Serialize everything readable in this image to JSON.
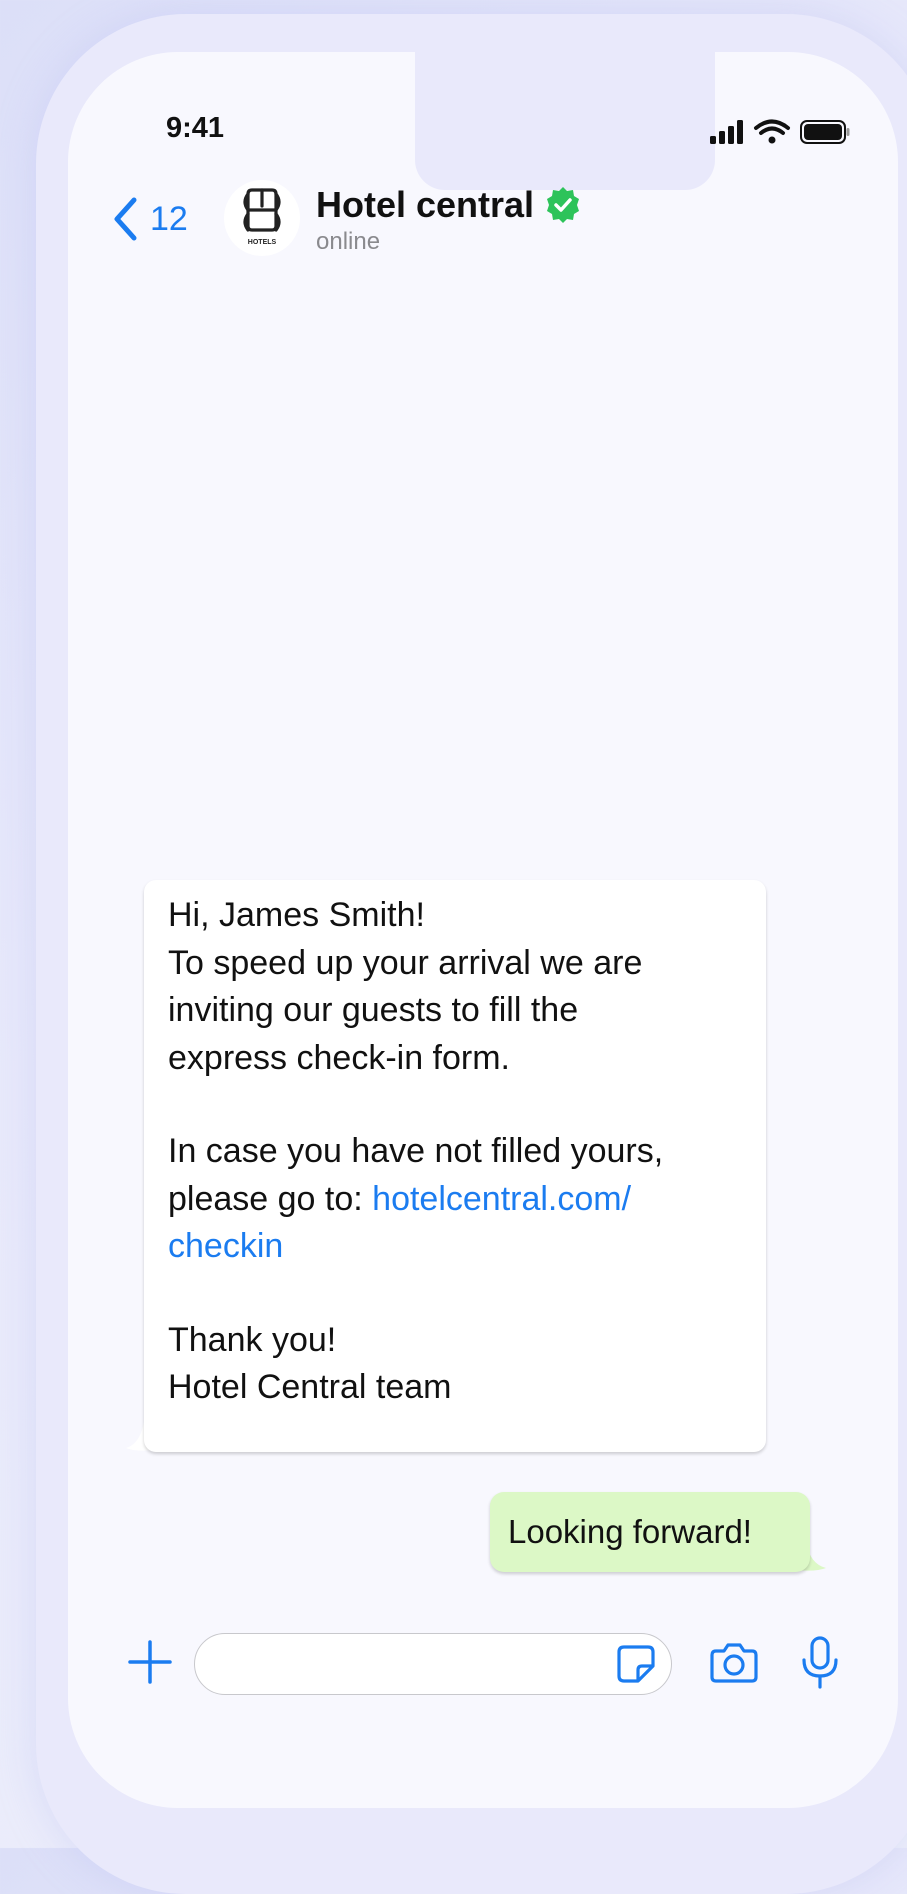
{
  "status_bar": {
    "time": "9:41"
  },
  "header": {
    "back_count": "12",
    "contact_name": "Hotel central",
    "contact_status": "online",
    "avatar_text": "HOTELS"
  },
  "messages": {
    "incoming": {
      "line1": "Hi, James Smith!",
      "line2": "To speed up your arrival we are",
      "line3": "inviting our guests to fill the",
      "line4": "express check-in form.",
      "line5": "In case you have not filled yours,",
      "line6_prefix": "please go to: ",
      "link_part1": "hotelcentral.com/",
      "link_part2": "checkin",
      "line8": "Thank you!",
      "line9": "Hotel Central team"
    },
    "outgoing": {
      "text": "Looking forward!"
    }
  },
  "input_bar": {
    "placeholder": ""
  },
  "colors": {
    "accent": "#1b7cf0",
    "verified": "#2dc35a",
    "outgoing_bubble": "#dcf8c6",
    "incoming_bubble": "#ffffff"
  },
  "icons": [
    "signal-icon",
    "wifi-icon",
    "battery-icon",
    "chevron-left-icon",
    "verified-badge-icon",
    "plus-icon",
    "sticker-icon",
    "camera-icon",
    "microphone-icon"
  ]
}
